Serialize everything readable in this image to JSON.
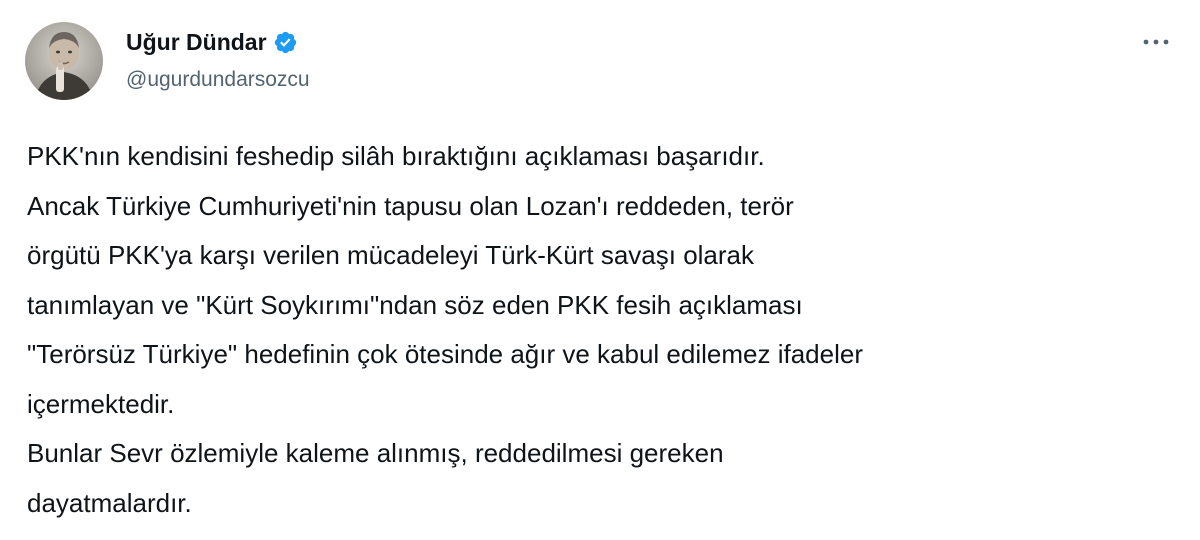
{
  "author": {
    "display_name": "Uğur Dündar",
    "handle": "@ugurdundarsozcu",
    "verified": true,
    "avatar_icon": "profile-photo-icon"
  },
  "icons": {
    "verified": "verified-badge-icon",
    "more": "more-options-icon"
  },
  "colors": {
    "verified_badge": "#1d9bf0",
    "text_primary": "#0f1419",
    "text_secondary": "#536471"
  },
  "tweet": {
    "lines": [
      "PKK'nın kendisini feshedip silâh bıraktığını açıklaması başarıdır.",
      "Ancak Türkiye Cumhuriyeti'nin tapusu olan Lozan'ı reddeden, terör",
      "örgütü PKK'ya karşı verilen mücadeleyi Türk-Kürt savaşı olarak",
      "tanımlayan ve \"Kürt Soykırımı\"ndan söz eden PKK fesih açıklaması",
      "\"Terörsüz Türkiye\" hedefinin çok ötesinde ağır ve kabul edilemez ifadeler",
      "içermektedir.",
      "Bunlar Sevr özlemiyle kaleme alınmış, reddedilmesi gereken",
      "dayatmalardır."
    ]
  }
}
